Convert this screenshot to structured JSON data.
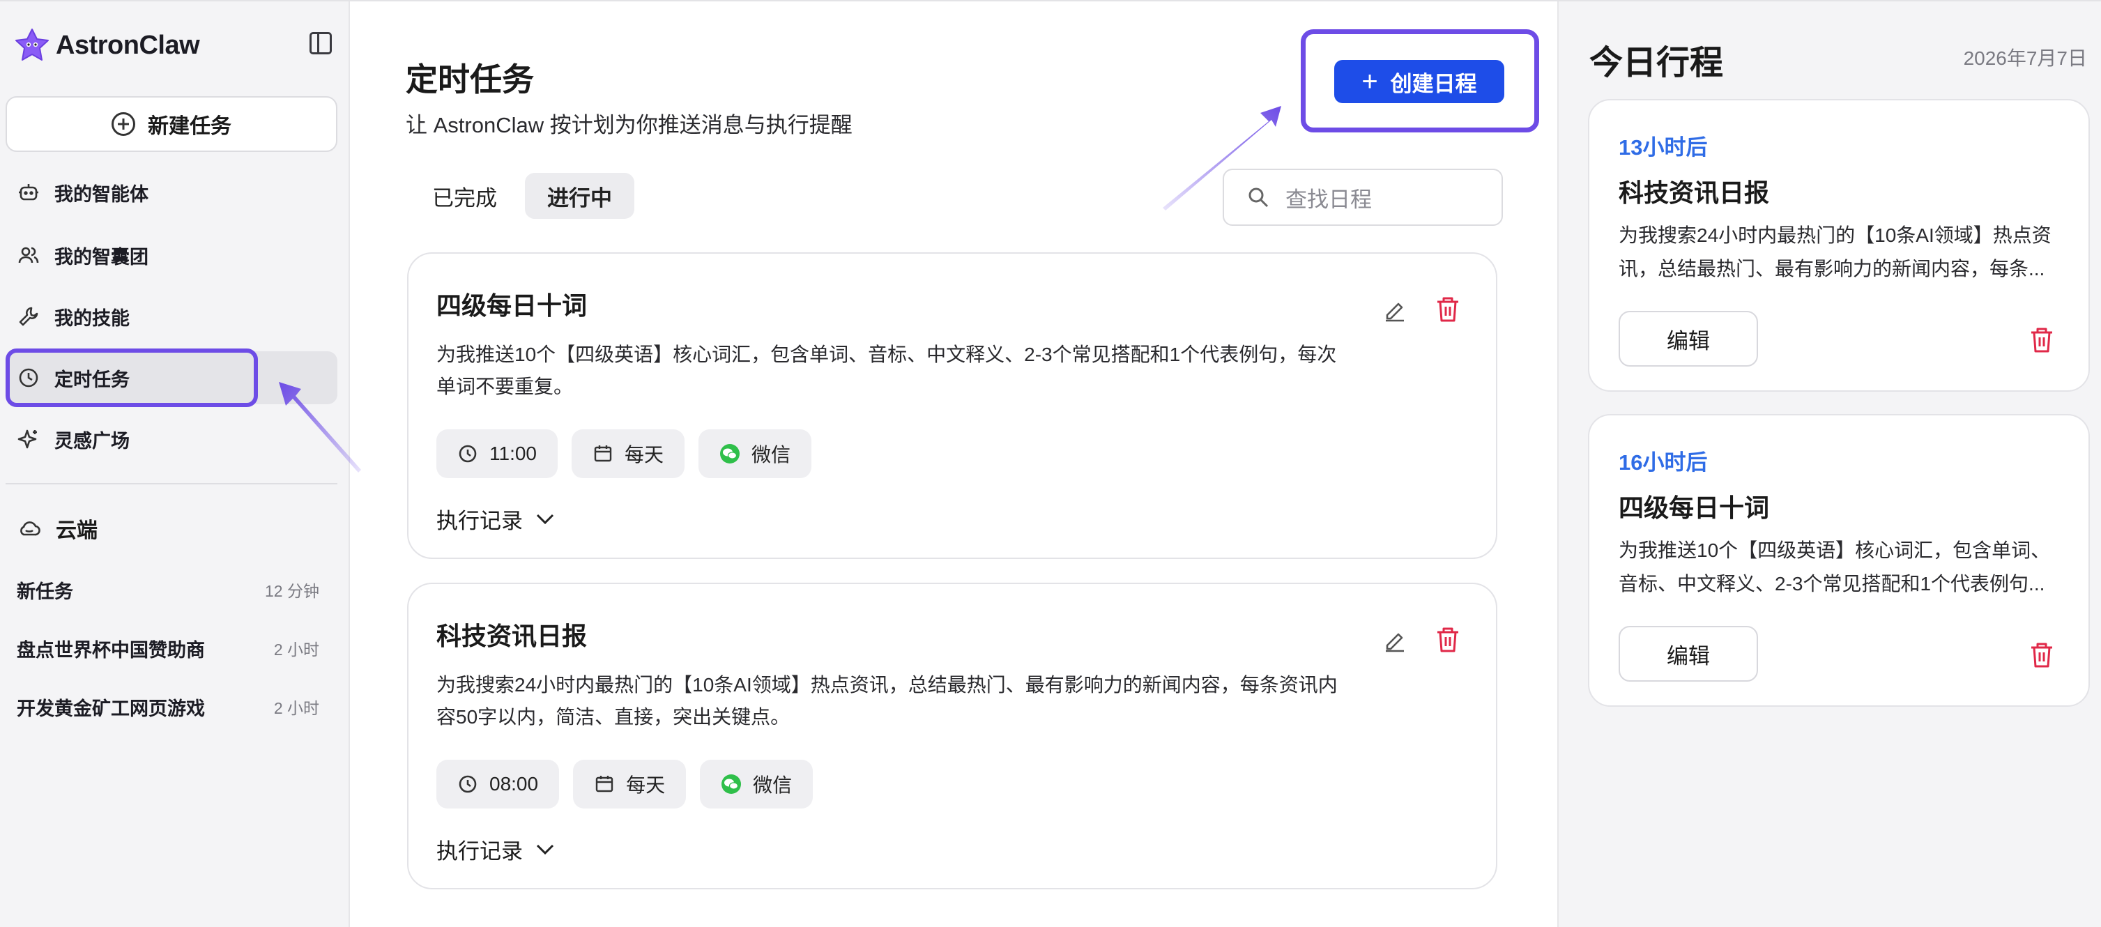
{
  "app": {
    "name": "AstronClaw"
  },
  "sidebar": {
    "new_task_label": "新建任务",
    "items": [
      {
        "label": "我的智能体",
        "icon": "robot-icon"
      },
      {
        "label": "我的智囊团",
        "icon": "team-icon"
      },
      {
        "label": "我的技能",
        "icon": "wrench-icon"
      },
      {
        "label": "定时任务",
        "icon": "clock-icon",
        "active": true
      },
      {
        "label": "灵感广场",
        "icon": "sparkle-icon"
      }
    ],
    "cloud_label": "云端",
    "recent": [
      {
        "title": "新任务",
        "meta": "12 分钟"
      },
      {
        "title": "盘点世界杯中国赞助商",
        "meta": "2 小时"
      },
      {
        "title": "开发黄金矿工网页游戏",
        "meta": "2 小时"
      }
    ]
  },
  "main": {
    "title": "定时任务",
    "subtitle": "让 AstronClaw 按计划为你推送消息与执行提醒",
    "create_button": "创建日程",
    "tabs": [
      {
        "label": "已完成"
      },
      {
        "label": "进行中",
        "active": true
      }
    ],
    "search_placeholder": "查找日程",
    "tasks": [
      {
        "title": "四级每日十词",
        "description": "为我推送10个【四级英语】核心词汇，包含单词、音标、中文释义、2-3个常见搭配和1个代表例句，每次单词不要重复。",
        "time": "11:00",
        "repeat": "每天",
        "channel": "微信",
        "log_label": "执行记录"
      },
      {
        "title": "科技资讯日报",
        "description": "为我搜索24小时内最热门的【10条AI领域】热点资讯，总结最热门、最有影响力的新闻内容，每条资讯内容50字以内，简洁、直接，突出关键点。",
        "time": "08:00",
        "repeat": "每天",
        "channel": "微信",
        "log_label": "执行记录"
      }
    ]
  },
  "today": {
    "title": "今日行程",
    "date": "2026年7月7日",
    "items": [
      {
        "when": "13小时后",
        "title": "科技资讯日报",
        "line1": "为我搜索24小时内最热门的【10条AI领域】热点资",
        "line2": "讯，总结最热门、最有影响力的新闻内容，每条...",
        "edit_label": "编辑"
      },
      {
        "when": "16小时后",
        "title": "四级每日十词",
        "line1": "为我推送10个【四级英语】核心词汇，包含单词、",
        "line2": "音标、中文释义、2-3个常见搭配和1个代表例句...",
        "edit_label": "编辑"
      }
    ]
  },
  "colors": {
    "accent_blue": "#1e4de8",
    "highlight_purple": "#6d4ce6",
    "delete_red": "#e02848",
    "wechat_green": "#2fbf4a",
    "relative_time_blue": "#2f6ce6"
  }
}
